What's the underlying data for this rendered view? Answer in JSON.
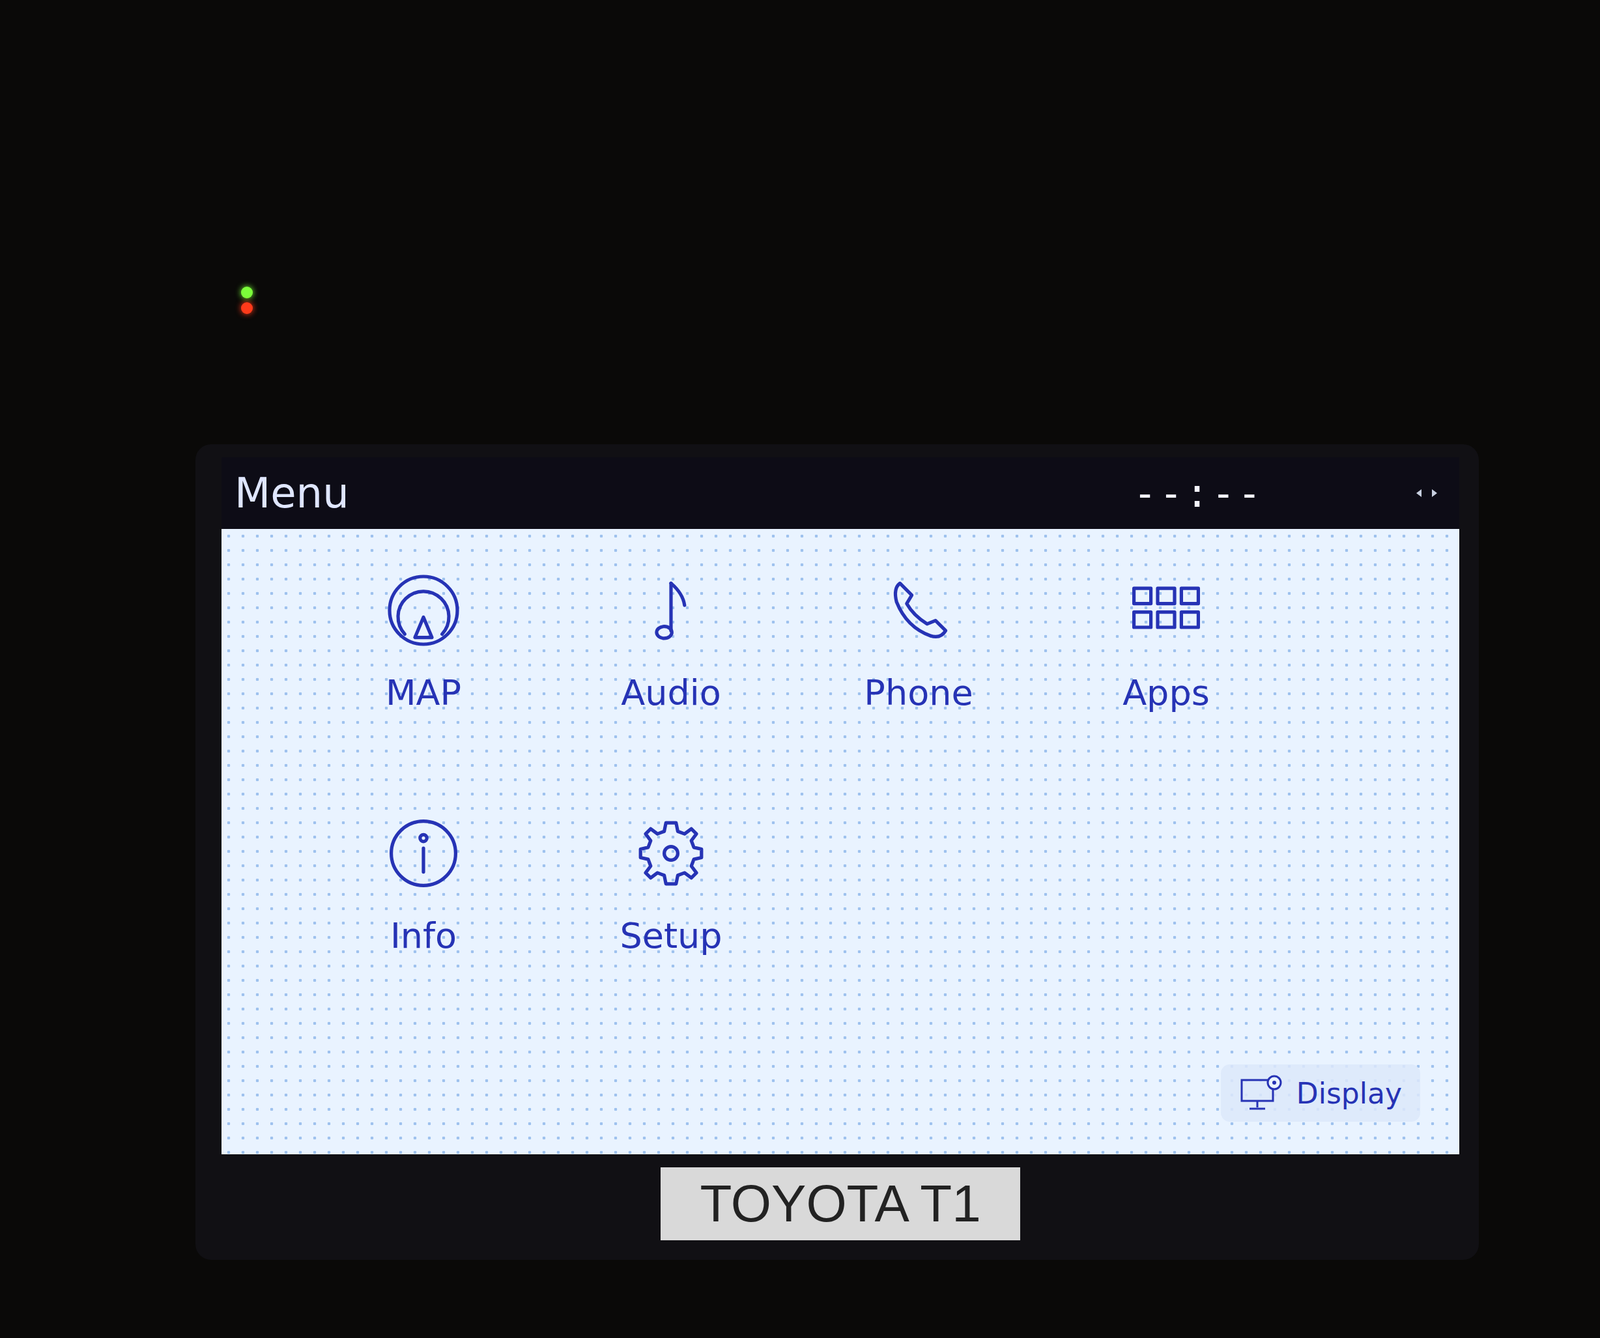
{
  "leds": [
    {
      "color": "#7cff3a"
    },
    {
      "color": "#ff3a1a"
    }
  ],
  "header": {
    "title": "Menu",
    "clock": "--:--"
  },
  "menu_items": [
    {
      "label": "MAP",
      "kind": "map"
    },
    {
      "label": "Audio",
      "kind": "audio"
    },
    {
      "label": "Phone",
      "kind": "phone"
    },
    {
      "label": "Apps",
      "kind": "apps"
    },
    {
      "label": "Info",
      "kind": "info"
    },
    {
      "label": "Setup",
      "kind": "setup"
    }
  ],
  "display_button": {
    "label": "Display"
  },
  "device_label": "TOYOTA T1"
}
